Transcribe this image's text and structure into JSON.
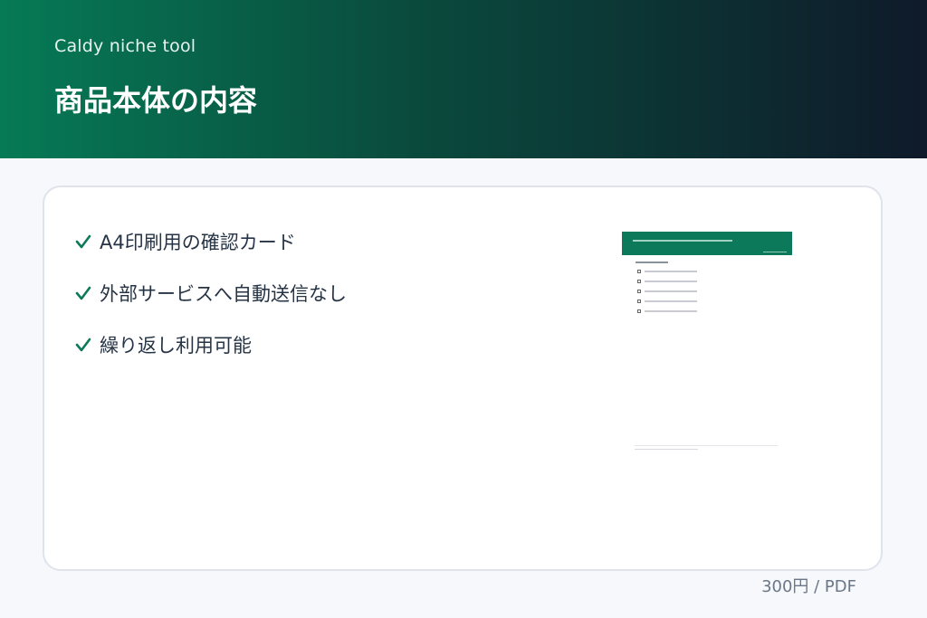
{
  "header": {
    "brand": "Caldy niche tool",
    "title": "商品本体の内容"
  },
  "features": [
    {
      "label": "A4印刷用の確認カード",
      "icon": "check-icon"
    },
    {
      "label": "外部サービスへ自動送信なし",
      "icon": "check-icon"
    },
    {
      "label": "繰り返し利用可能",
      "icon": "check-icon"
    }
  ],
  "price": "300円 / PDF",
  "colors": {
    "accent": "#0c7a5a",
    "header_start": "#067a55",
    "header_end": "#0f1a2a",
    "text": "#263445",
    "muted": "#6b7788"
  }
}
